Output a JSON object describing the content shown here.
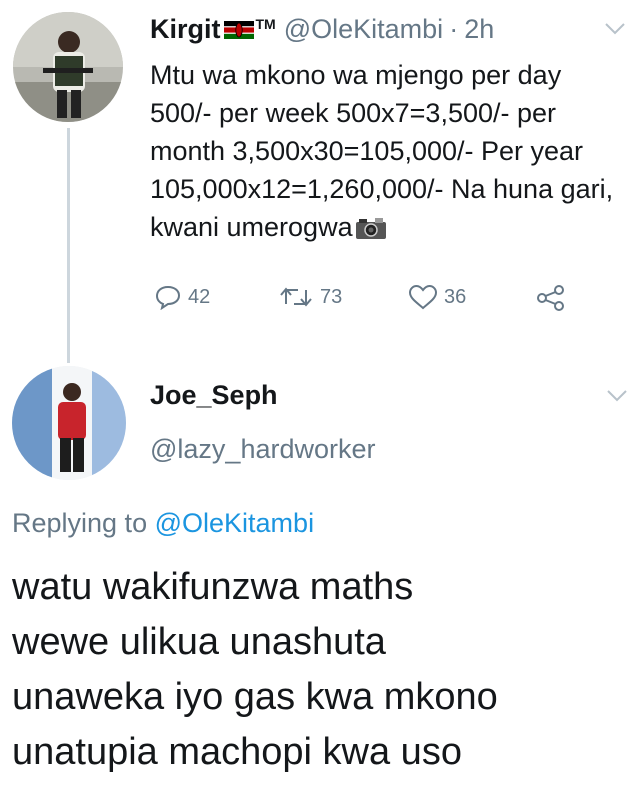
{
  "original_tweet": {
    "display_name": "Kirgit",
    "flag_icon": "kenya-flag-icon",
    "trademark": "TM",
    "handle": "@OleKitambi",
    "separator": "·",
    "time": "2h",
    "text": "Mtu wa mkono wa mjengo per day 500/- per week 500x7=3,500/- per month 3,500x30=105,000/- Per year 105,000x12=1,260,000/- Na huna gari, kwani umerogwa",
    "emoji_icon": "camera-with-flash-icon",
    "actions": {
      "reply_count": "42",
      "retweet_count": "73",
      "like_count": "36"
    }
  },
  "reply_tweet": {
    "display_name": "Joe_Seph",
    "handle": "@lazy_hardworker",
    "replying_prefix": "Replying to",
    "replying_mention": "@OleKitambi",
    "lines": [
      "watu wakifunzwa maths",
      "wewe ulikua unashuta",
      "unaweka iyo gas kwa mkono",
      "unatupia machopi kwa uso"
    ]
  },
  "colors": {
    "text_primary": "#14171a",
    "text_secondary": "#657786",
    "link": "#1b95e0",
    "thread_line": "#cdd6dd"
  }
}
